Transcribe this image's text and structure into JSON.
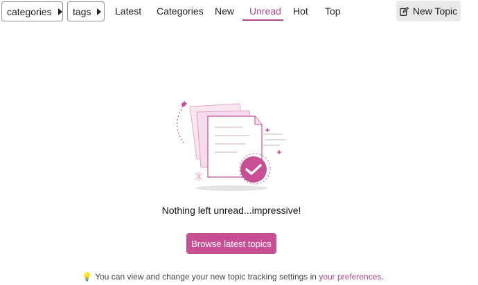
{
  "filters": {
    "categories_label": "categories",
    "tags_label": "tags"
  },
  "nav": {
    "tabs": [
      {
        "label": "Latest",
        "active": false
      },
      {
        "label": "Categories",
        "active": false
      },
      {
        "label": "New",
        "active": false
      },
      {
        "label": "Unread",
        "active": true
      },
      {
        "label": "Hot",
        "active": false
      },
      {
        "label": "Top",
        "active": false
      }
    ]
  },
  "header": {
    "new_topic_label": "New Topic",
    "new_topic_icon": "pencil-square-icon"
  },
  "empty_state": {
    "message": "Nothing left unread...impressive!",
    "button_label": "Browse latest topics",
    "illustration": "documents-checkmark-illustration"
  },
  "tip": {
    "icon": "lightbulb-icon",
    "text": "You can view and change your new topic tracking settings in",
    "link_text": "your preferences",
    "suffix": "."
  },
  "colors": {
    "accent": "#b5488b",
    "button": "#c94f94",
    "new_topic_bg": "#e9e9e9"
  }
}
